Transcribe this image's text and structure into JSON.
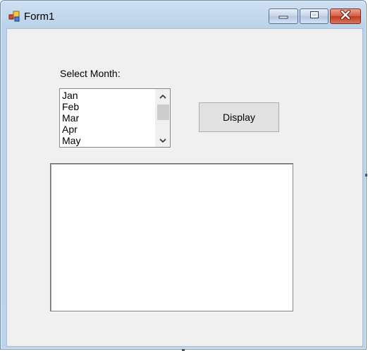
{
  "window": {
    "title": "Form1",
    "icon": "winforms-app-icon",
    "controls": {
      "minimize_icon": "minimize-icon",
      "maximize_icon": "maximize-icon",
      "close_icon": "close-icon"
    }
  },
  "form": {
    "month_label": "Select Month:",
    "months": [
      "Jan",
      "Feb",
      "Mar",
      "Apr",
      "May"
    ],
    "display_button": "Display",
    "output_text": ""
  },
  "colors": {
    "client_background": "#f0f0f0",
    "close_button": "#c0391f",
    "button_face": "#e1e1e1"
  }
}
